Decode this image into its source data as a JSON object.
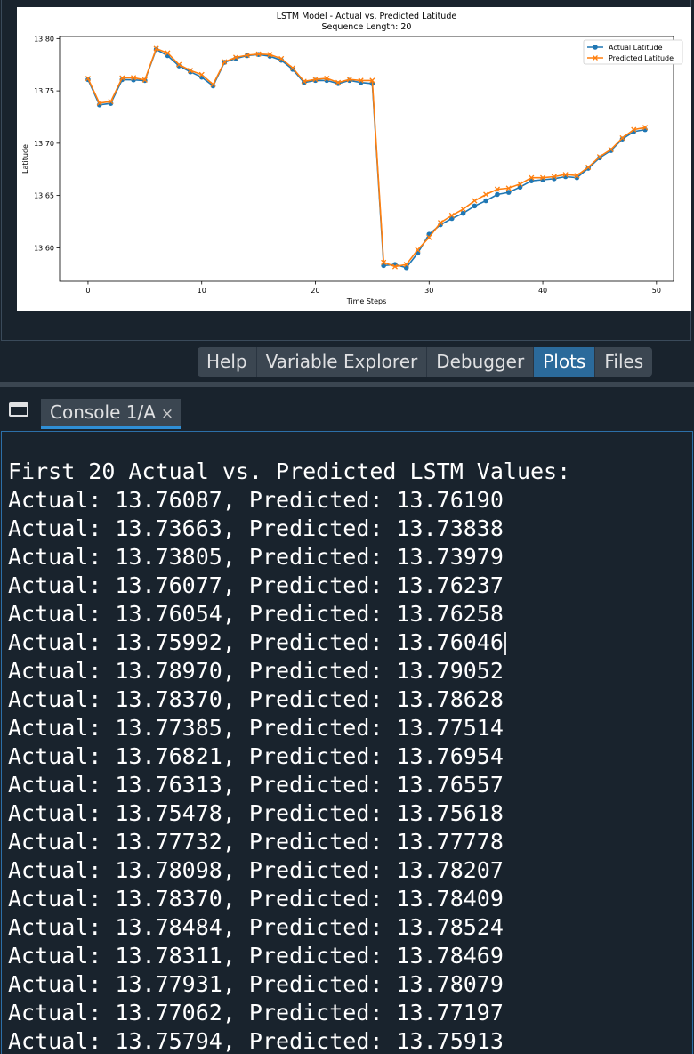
{
  "plot_pane": {
    "chart_data": {
      "type": "line",
      "title": "LSTM Model - Actual vs. Predicted Latitude",
      "subtitle": "Sequence Length: 20",
      "xlabel": "Time Steps",
      "ylabel": "Latitude",
      "xlim": [
        -2.5,
        51.5
      ],
      "ylim": [
        13.568,
        13.802
      ],
      "x_ticks": [
        "0",
        "10",
        "20",
        "30",
        "40",
        "50"
      ],
      "y_ticks": [
        "13.60",
        "13.65",
        "13.70",
        "13.75",
        "13.80"
      ],
      "legend_position": "top-right",
      "grid": false,
      "x": [
        0,
        1,
        2,
        3,
        4,
        5,
        6,
        7,
        8,
        9,
        10,
        11,
        12,
        13,
        14,
        15,
        16,
        17,
        18,
        19,
        20,
        21,
        22,
        23,
        24,
        25,
        26,
        27,
        28,
        29,
        30,
        31,
        32,
        33,
        34,
        35,
        36,
        37,
        38,
        39,
        40,
        41,
        42,
        43,
        44,
        45,
        46,
        47,
        48,
        49
      ],
      "series": [
        {
          "name": "Actual Latitude",
          "color": "#1f77b4",
          "marker": "circle",
          "values": [
            13.76087,
            13.73663,
            13.73805,
            13.76077,
            13.76054,
            13.75992,
            13.7897,
            13.7837,
            13.77385,
            13.76821,
            13.76313,
            13.75478,
            13.77732,
            13.78098,
            13.7837,
            13.78484,
            13.78311,
            13.77931,
            13.77062,
            13.75794,
            13.76,
            13.76,
            13.757,
            13.76,
            13.758,
            13.757,
            13.583,
            13.584,
            13.581,
            13.595,
            13.613,
            13.622,
            13.628,
            13.633,
            13.64,
            13.645,
            13.651,
            13.653,
            13.658,
            13.664,
            13.665,
            13.666,
            13.668,
            13.667,
            13.676,
            13.686,
            13.693,
            13.704,
            13.711,
            13.713
          ]
        },
        {
          "name": "Predicted Latitude",
          "color": "#ff7f0e",
          "marker": "x",
          "values": [
            13.7619,
            13.73838,
            13.73979,
            13.76237,
            13.76258,
            13.76046,
            13.79052,
            13.78628,
            13.77514,
            13.76954,
            13.76557,
            13.75618,
            13.77778,
            13.78207,
            13.78409,
            13.78524,
            13.78469,
            13.78079,
            13.77197,
            13.75913,
            13.761,
            13.762,
            13.758,
            13.761,
            13.76,
            13.76,
            13.586,
            13.582,
            13.584,
            13.598,
            13.61,
            13.624,
            13.631,
            13.637,
            13.645,
            13.651,
            13.656,
            13.657,
            13.661,
            13.667,
            13.667,
            13.668,
            13.67,
            13.669,
            13.677,
            13.687,
            13.694,
            13.705,
            13.713,
            13.715
          ]
        }
      ]
    }
  },
  "tabs": [
    {
      "label": "Help",
      "active": false
    },
    {
      "label": "Variable Explorer",
      "active": false
    },
    {
      "label": "Debugger",
      "active": false
    },
    {
      "label": "Plots",
      "active": true
    },
    {
      "label": "Files",
      "active": false
    }
  ],
  "console": {
    "tab_label": "Console 1/A",
    "close_glyph": "×",
    "icon": "console-window-icon",
    "lines": [
      "First 20 Actual vs. Predicted LSTM Values:",
      "Actual: 13.76087, Predicted: 13.76190",
      "Actual: 13.73663, Predicted: 13.73838",
      "Actual: 13.73805, Predicted: 13.73979",
      "Actual: 13.76077, Predicted: 13.76237",
      "Actual: 13.76054, Predicted: 13.76258",
      "Actual: 13.75992, Predicted: 13.76046",
      "Actual: 13.78970, Predicted: 13.79052",
      "Actual: 13.78370, Predicted: 13.78628",
      "Actual: 13.77385, Predicted: 13.77514",
      "Actual: 13.76821, Predicted: 13.76954",
      "Actual: 13.76313, Predicted: 13.76557",
      "Actual: 13.75478, Predicted: 13.75618",
      "Actual: 13.77732, Predicted: 13.77778",
      "Actual: 13.78098, Predicted: 13.78207",
      "Actual: 13.78370, Predicted: 13.78409",
      "Actual: 13.78484, Predicted: 13.78524",
      "Actual: 13.78311, Predicted: 13.78469",
      "Actual: 13.77931, Predicted: 13.78079",
      "Actual: 13.77062, Predicted: 13.77197",
      "Actual: 13.75794, Predicted: 13.75913"
    ]
  }
}
